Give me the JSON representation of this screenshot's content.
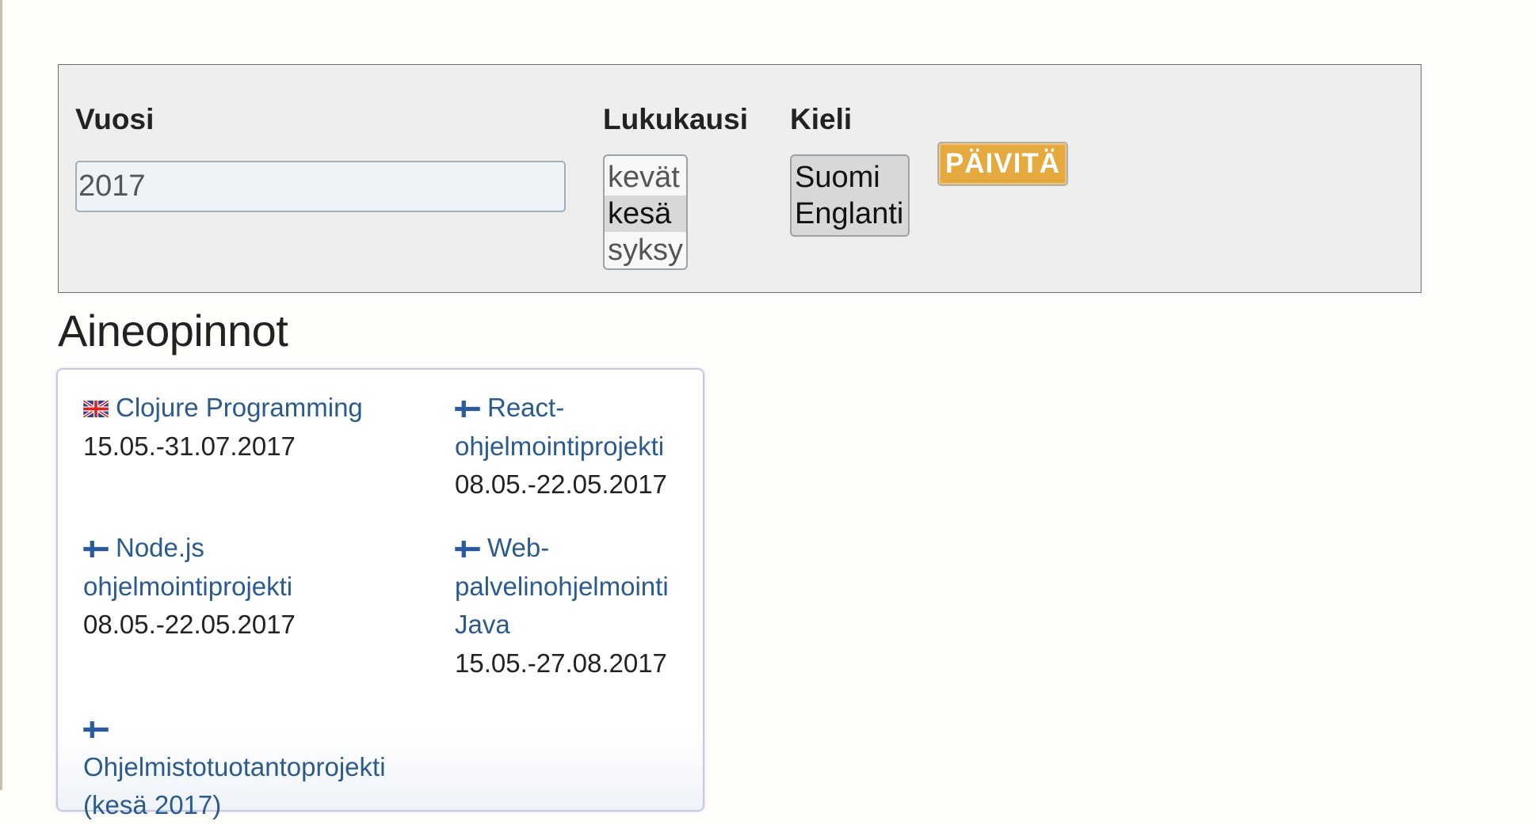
{
  "filters": {
    "year_label": "Vuosi",
    "year_value": "2017",
    "term_label": "Lukukausi",
    "term_options": [
      {
        "label": "kevät",
        "selected": false
      },
      {
        "label": "kesä",
        "selected": true
      },
      {
        "label": "syksy",
        "selected": false
      }
    ],
    "language_label": "Kieli",
    "language_options": [
      {
        "label": "Suomi",
        "selected": true
      },
      {
        "label": "Englanti",
        "selected": true
      }
    ],
    "update_button": "PÄIVITÄ"
  },
  "section": {
    "title": "Aineopinnot",
    "courses": [
      {
        "lang_flag": "uk-flag-icon",
        "title_lines": [
          "Clojure Programming"
        ],
        "dates": "15.05.-31.07.2017"
      },
      {
        "lang_flag": "finland-flag-icon",
        "title_lines": [
          "React-",
          "ohjelmointiprojekti"
        ],
        "dates": "08.05.-22.05.2017"
      },
      {
        "lang_flag": "finland-flag-icon",
        "title_lines": [
          "Node.js",
          "ohjelmointiprojekti"
        ],
        "dates": "08.05.-22.05.2017"
      },
      {
        "lang_flag": "finland-flag-icon",
        "title_lines": [
          "Web-",
          "palvelinohjelmointi",
          "Java"
        ],
        "dates": "15.05.-27.08.2017"
      },
      {
        "lang_flag": "finland-flag-icon",
        "title_lines": [
          "",
          "Ohjelmistotuotantoprojekti",
          "(kesä 2017)"
        ],
        "dates": ""
      }
    ]
  },
  "colors": {
    "link": "#2a5a8e",
    "button": "#e6a93e",
    "panel_bg": "#eeeeee"
  }
}
